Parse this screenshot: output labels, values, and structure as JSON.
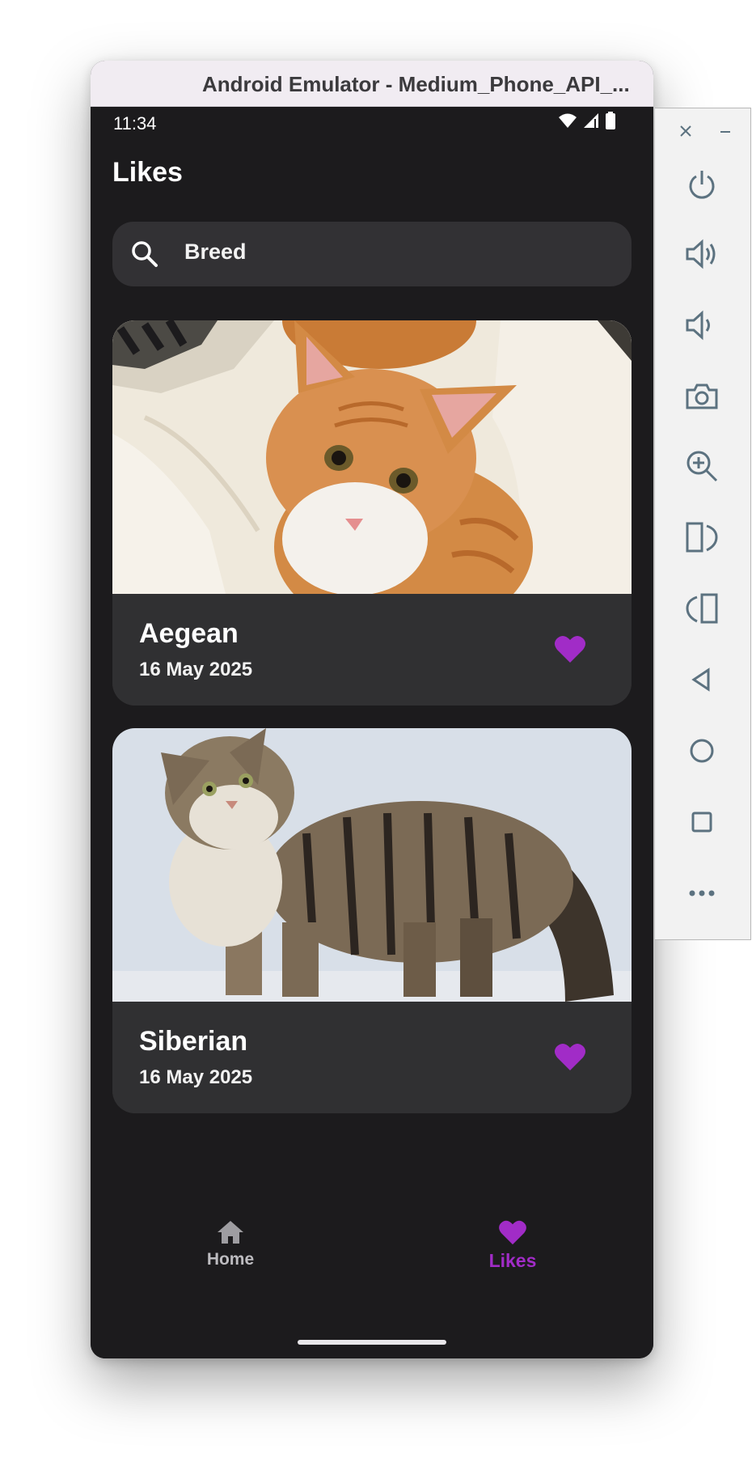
{
  "window": {
    "title": "Android Emulator - Medium_Phone_API_..."
  },
  "statusbar": {
    "time": "11:34",
    "icons": [
      "wifi-icon",
      "signal-icon",
      "battery-icon"
    ]
  },
  "page": {
    "title": "Likes"
  },
  "search": {
    "value": "Breed",
    "icon": "search-icon"
  },
  "cards": [
    {
      "name": "Aegean",
      "date": "16 May 2025",
      "liked": true,
      "photo": "orange tabby cat on white cushion"
    },
    {
      "name": "Siberian",
      "date": "16 May 2025",
      "liked": true,
      "photo": "long-haired brown tabby cat standing"
    }
  ],
  "bottom_nav": {
    "items": [
      {
        "label": "Home",
        "icon": "home-icon",
        "active": false
      },
      {
        "label": "Likes",
        "icon": "heart-icon",
        "active": true
      }
    ]
  },
  "emulator_toolbar": {
    "buttons": [
      "close-icon",
      "minimize-icon",
      "power-icon",
      "volume-up-icon",
      "volume-down-icon",
      "camera-icon",
      "zoom-icon",
      "rotate-left-icon",
      "rotate-right-icon",
      "back-icon",
      "home-circle-icon",
      "overview-icon",
      "more-icon"
    ]
  },
  "colors": {
    "accent": "#a12cc7",
    "screen_bg": "#1c1b1d",
    "card_bg": "#303032",
    "search_bg": "#323134",
    "titlebar_bg": "#f1ecf2",
    "toolbar_icon": "#5c7280"
  }
}
